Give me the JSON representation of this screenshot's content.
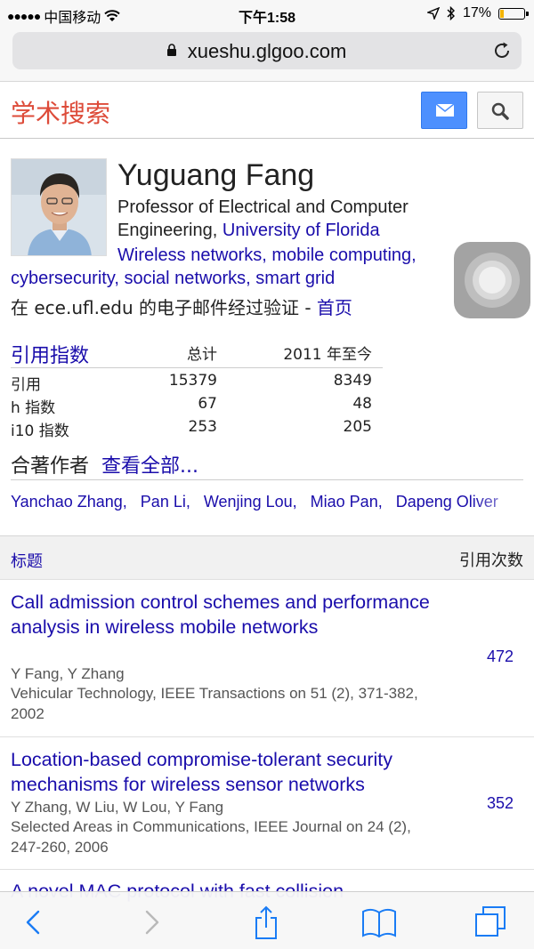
{
  "status_bar": {
    "carrier": "中国移动",
    "time": "下午1:58",
    "battery_text": "17%",
    "battery_level": 0.17
  },
  "url_bar": {
    "domain": "xueshu.glgoo.com"
  },
  "header": {
    "logo": "学术搜索"
  },
  "profile": {
    "name": "Yuguang Fang",
    "affiliation_prefix": "Professor of Electrical and Computer Engineering,",
    "affiliation_link": "University of Florida",
    "interests": [
      "Wireless networks",
      "mobile computing",
      "cybersecurity",
      "social networks",
      "smart grid"
    ],
    "verified_text": "在 ece.ufl.edu 的电子邮件经过验证 - ",
    "homepage_link": "首页"
  },
  "citations": {
    "title": "引用指数",
    "col_total": "总计",
    "col_since": "2011 年至今",
    "rows": [
      {
        "label": "引用",
        "total": "15379",
        "since": "8349"
      },
      {
        "label": "h 指数",
        "total": "67",
        "since": "48"
      },
      {
        "label": "i10 指数",
        "total": "253",
        "since": "205"
      }
    ]
  },
  "coauthors": {
    "label": "合著作者",
    "view_all": "查看全部...",
    "names": [
      "Yanchao Zhang",
      "Pan Li",
      "Wenjing Lou",
      "Miao Pan",
      "Dapeng Oliver"
    ]
  },
  "list_header": {
    "title": "标题",
    "cited_by": "引用次数"
  },
  "papers": [
    {
      "title": "Call admission control schemes and performance analysis in wireless mobile networks",
      "authors": "Y Fang, Y Zhang",
      "venue": "Vehicular Technology, IEEE Transactions on 51 (2), 371-382, 2002",
      "citations": "472"
    },
    {
      "title": "Location-based compromise-tolerant security mechanisms for wireless sensor networks",
      "authors": "Y Zhang, W Liu, W Lou, Y Fang",
      "venue": "Selected Areas in Communications, IEEE Journal on 24 (2), 247-260, 2006",
      "citations": "352"
    },
    {
      "title": "A novel MAC protocol with fast collision"
    }
  ],
  "colors": {
    "link": "#1a0dab",
    "logo": "#dd4b39",
    "mail_button": "#4d90fe",
    "battery": "#f4b400"
  }
}
